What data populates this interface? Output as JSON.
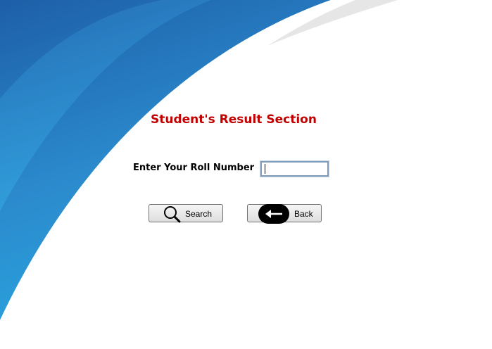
{
  "page": {
    "title": "Student's Result Section"
  },
  "form": {
    "roll_label": "Enter Your Roll Number",
    "roll_value": ""
  },
  "buttons": {
    "search_label": "Search",
    "search_icon": "magnifier-icon",
    "back_label": "Back",
    "back_icon": "arrow-left-icon"
  },
  "colors": {
    "title": "#c00000",
    "swoosh_dark": "#1d5fa8",
    "swoosh_light": "#2aa4de",
    "input_border": "#7f9db9"
  }
}
